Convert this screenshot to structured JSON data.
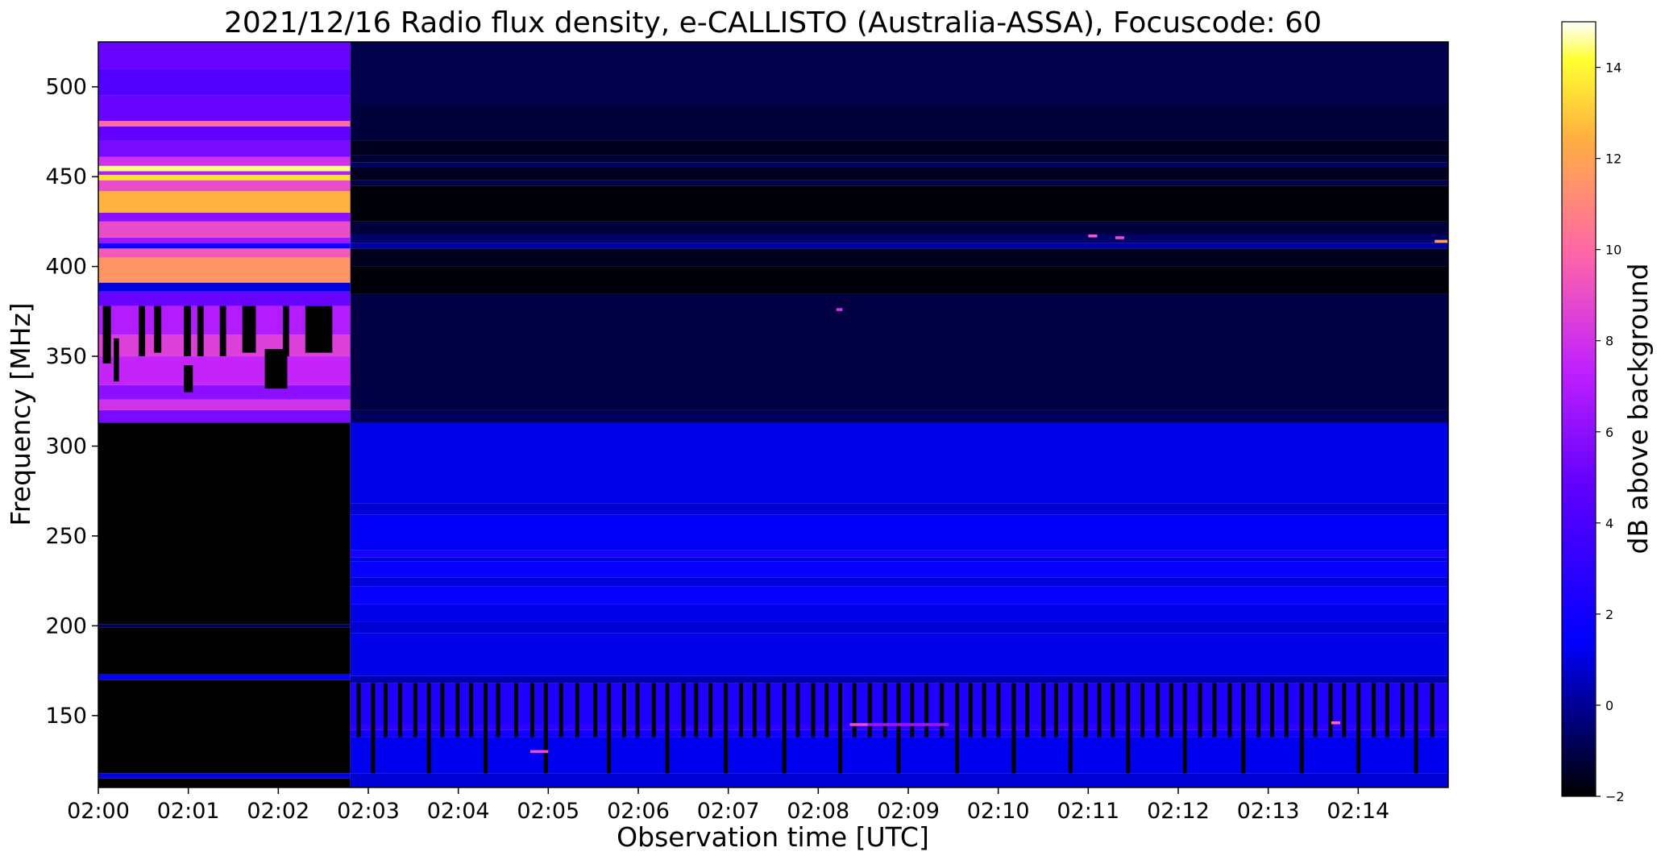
{
  "chart_data": {
    "type": "heatmap",
    "title": "2021/12/16  Radio flux density, e-CALLISTO (Australia-ASSA), Focuscode: 60",
    "xlabel": "Observation time [UTC]",
    "ylabel": "Frequency [MHz]",
    "colorbar_label": "dB above background",
    "x_ticks": [
      "02:00",
      "02:01",
      "02:02",
      "02:03",
      "02:04",
      "02:05",
      "02:06",
      "02:07",
      "02:08",
      "02:09",
      "02:10",
      "02:11",
      "02:12",
      "02:13",
      "02:14"
    ],
    "x_range_minutes": [
      0,
      15
    ],
    "y_ticks": [
      150,
      200,
      250,
      300,
      350,
      400,
      450,
      500
    ],
    "ylim": [
      110,
      525
    ],
    "colorbar_ticks": [
      -2,
      0,
      2,
      4,
      6,
      8,
      10,
      12,
      14
    ],
    "colorbar_range": [
      -2,
      15
    ],
    "colormap": "gnuplot2",
    "colormap_stops": [
      {
        "v": 0.0,
        "color": "#000000"
      },
      {
        "v": 0.2,
        "color": "#0000ff"
      },
      {
        "v": 0.4,
        "color": "#6000ff"
      },
      {
        "v": 0.55,
        "color": "#c020ff"
      },
      {
        "v": 0.7,
        "color": "#ff66a8"
      },
      {
        "v": 0.85,
        "color": "#ffb040"
      },
      {
        "v": 0.95,
        "color": "#ffff30"
      },
      {
        "v": 1.0,
        "color": "#ffffff"
      }
    ],
    "frequency_bands_early": [
      {
        "f0": 110,
        "f1": 115,
        "db": -2.0
      },
      {
        "f0": 115,
        "f1": 118,
        "db": 1.0
      },
      {
        "f0": 118,
        "f1": 170,
        "db": -2.0
      },
      {
        "f0": 170,
        "f1": 173,
        "db": 1.5
      },
      {
        "f0": 173,
        "f1": 199,
        "db": -2.0
      },
      {
        "f0": 199,
        "f1": 201,
        "db": -0.8
      },
      {
        "f0": 201,
        "f1": 313,
        "db": -2.0
      },
      {
        "f0": 313,
        "f1": 320,
        "db": 5.5
      },
      {
        "f0": 320,
        "f1": 326,
        "db": 8.0
      },
      {
        "f0": 326,
        "f1": 334,
        "db": 6.0
      },
      {
        "f0": 334,
        "f1": 350,
        "db": 7.5
      },
      {
        "f0": 350,
        "f1": 362,
        "db": 8.5
      },
      {
        "f0": 362,
        "f1": 378,
        "db": 7.0
      },
      {
        "f0": 378,
        "f1": 386,
        "db": 5.0
      },
      {
        "f0": 386,
        "f1": 391,
        "db": 1.0
      },
      {
        "f0": 391,
        "f1": 405,
        "db": 11.5
      },
      {
        "f0": 405,
        "f1": 410,
        "db": 9.5
      },
      {
        "f0": 410,
        "f1": 413,
        "db": 2.0
      },
      {
        "f0": 413,
        "f1": 416,
        "db": 6.5
      },
      {
        "f0": 416,
        "f1": 425,
        "db": 9.0
      },
      {
        "f0": 425,
        "f1": 430,
        "db": 6.0
      },
      {
        "f0": 430,
        "f1": 442,
        "db": 12.5
      },
      {
        "f0": 442,
        "f1": 448,
        "db": 9.0
      },
      {
        "f0": 448,
        "f1": 451,
        "db": 13.5
      },
      {
        "f0": 451,
        "f1": 453,
        "db": 7.0
      },
      {
        "f0": 453,
        "f1": 456,
        "db": 14.5
      },
      {
        "f0": 456,
        "f1": 461,
        "db": 8.0
      },
      {
        "f0": 461,
        "f1": 470,
        "db": 5.5
      },
      {
        "f0": 470,
        "f1": 478,
        "db": 4.8
      },
      {
        "f0": 478,
        "f1": 481,
        "db": 10.0
      },
      {
        "f0": 481,
        "f1": 495,
        "db": 5.0
      },
      {
        "f0": 495,
        "f1": 510,
        "db": 4.3
      },
      {
        "f0": 510,
        "f1": 525,
        "db": 5.0
      }
    ],
    "frequency_bands_late": [
      {
        "f0": 110,
        "f1": 118,
        "db": 0.8
      },
      {
        "f0": 118,
        "f1": 138,
        "db": 1.2
      },
      {
        "f0": 138,
        "f1": 142,
        "db": 2.0
      },
      {
        "f0": 142,
        "f1": 145,
        "db": 3.0
      },
      {
        "f0": 145,
        "f1": 168,
        "db": 2.5
      },
      {
        "f0": 168,
        "f1": 172,
        "db": 0.3
      },
      {
        "f0": 172,
        "f1": 196,
        "db": 1.1
      },
      {
        "f0": 196,
        "f1": 202,
        "db": 0.8
      },
      {
        "f0": 202,
        "f1": 212,
        "db": 1.1
      },
      {
        "f0": 212,
        "f1": 222,
        "db": 1.6
      },
      {
        "f0": 222,
        "f1": 227,
        "db": 0.9
      },
      {
        "f0": 227,
        "f1": 236,
        "db": 1.6
      },
      {
        "f0": 236,
        "f1": 238,
        "db": 1.0
      },
      {
        "f0": 238,
        "f1": 242,
        "db": 2.2
      },
      {
        "f0": 242,
        "f1": 262,
        "db": 1.3
      },
      {
        "f0": 262,
        "f1": 268,
        "db": 0.8
      },
      {
        "f0": 268,
        "f1": 313,
        "db": 1.1
      },
      {
        "f0": 313,
        "f1": 320,
        "db": -0.8
      },
      {
        "f0": 320,
        "f1": 385,
        "db": -1.1
      },
      {
        "f0": 385,
        "f1": 400,
        "db": -1.9
      },
      {
        "f0": 400,
        "f1": 410,
        "db": -1.6
      },
      {
        "f0": 410,
        "f1": 413,
        "db": 0.2
      },
      {
        "f0": 413,
        "f1": 418,
        "db": -0.6
      },
      {
        "f0": 418,
        "f1": 425,
        "db": -1.2
      },
      {
        "f0": 425,
        "f1": 445,
        "db": -1.9
      },
      {
        "f0": 445,
        "f1": 448,
        "db": -1.0
      },
      {
        "f0": 448,
        "f1": 455,
        "db": -1.6
      },
      {
        "f0": 455,
        "f1": 458,
        "db": -0.8
      },
      {
        "f0": 458,
        "f1": 462,
        "db": -1.3
      },
      {
        "f0": 462,
        "f1": 470,
        "db": -1.6
      },
      {
        "f0": 470,
        "f1": 490,
        "db": -1.2
      },
      {
        "f0": 490,
        "f1": 525,
        "db": -1.0
      }
    ],
    "instrument_switch_time_minutes": 2.8,
    "dropouts_early": [
      {
        "t0": 0.05,
        "t1": 0.14,
        "f0": 346,
        "f1": 378
      },
      {
        "t0": 0.17,
        "t1": 0.23,
        "f0": 336,
        "f1": 360
      },
      {
        "t0": 0.45,
        "t1": 0.52,
        "f0": 350,
        "f1": 378
      },
      {
        "t0": 0.62,
        "t1": 0.7,
        "f0": 352,
        "f1": 378
      },
      {
        "t0": 0.95,
        "t1": 1.03,
        "f0": 350,
        "f1": 378
      },
      {
        "t0": 0.95,
        "t1": 1.05,
        "f0": 330,
        "f1": 345
      },
      {
        "t0": 1.1,
        "t1": 1.17,
        "f0": 350,
        "f1": 378
      },
      {
        "t0": 1.35,
        "t1": 1.42,
        "f0": 350,
        "f1": 378
      },
      {
        "t0": 1.6,
        "t1": 1.75,
        "f0": 352,
        "f1": 378
      },
      {
        "t0": 1.85,
        "t1": 2.1,
        "f0": 332,
        "f1": 354
      },
      {
        "t0": 2.05,
        "t1": 2.12,
        "f0": 350,
        "f1": 378
      },
      {
        "t0": 2.3,
        "t1": 2.6,
        "f0": 352,
        "f1": 378
      }
    ],
    "dropouts_late_times_minutes": [
      2.87,
      3.03,
      3.17,
      3.33,
      3.5,
      3.65,
      3.8,
      3.97,
      4.12,
      4.28,
      4.42,
      4.62,
      4.8,
      4.95,
      5.12,
      5.3,
      5.5,
      5.65,
      5.82,
      5.97,
      6.15,
      6.3,
      6.48,
      6.62,
      6.78,
      6.95,
      7.12,
      7.27,
      7.42,
      7.6,
      7.75,
      7.92,
      8.07,
      8.22,
      8.38,
      8.55,
      8.72,
      8.87,
      9.02,
      9.18,
      9.35,
      9.52,
      9.67,
      9.82,
      9.98,
      10.15,
      10.3,
      10.48,
      10.62,
      10.78,
      10.95,
      11.1,
      11.25,
      11.42,
      11.58,
      11.75,
      11.9,
      12.05,
      12.22,
      12.38,
      12.55,
      12.7,
      12.87,
      13.02,
      13.18,
      13.35,
      13.5,
      13.67,
      13.82,
      13.98,
      14.15,
      14.3,
      14.47,
      14.62,
      14.8
    ],
    "bright_features": [
      {
        "t": 8.35,
        "t1": 8.55,
        "f": 145,
        "db": 9.0
      },
      {
        "t": 8.55,
        "t1": 9.45,
        "f": 145,
        "db": 6.5
      },
      {
        "t": 4.8,
        "t1": 5.0,
        "f": 130,
        "db": 9.0
      },
      {
        "t": 13.7,
        "t1": 13.8,
        "f": 146,
        "db": 10.0
      },
      {
        "t": 11.0,
        "t1": 11.1,
        "f": 417,
        "db": 9.5
      },
      {
        "t": 11.3,
        "t1": 11.4,
        "f": 416,
        "db": 9.0
      },
      {
        "t": 14.85,
        "t1": 15.0,
        "f": 414,
        "db": 12.0
      },
      {
        "t": 8.2,
        "t1": 8.27,
        "f": 376,
        "db": 8.0
      }
    ]
  }
}
